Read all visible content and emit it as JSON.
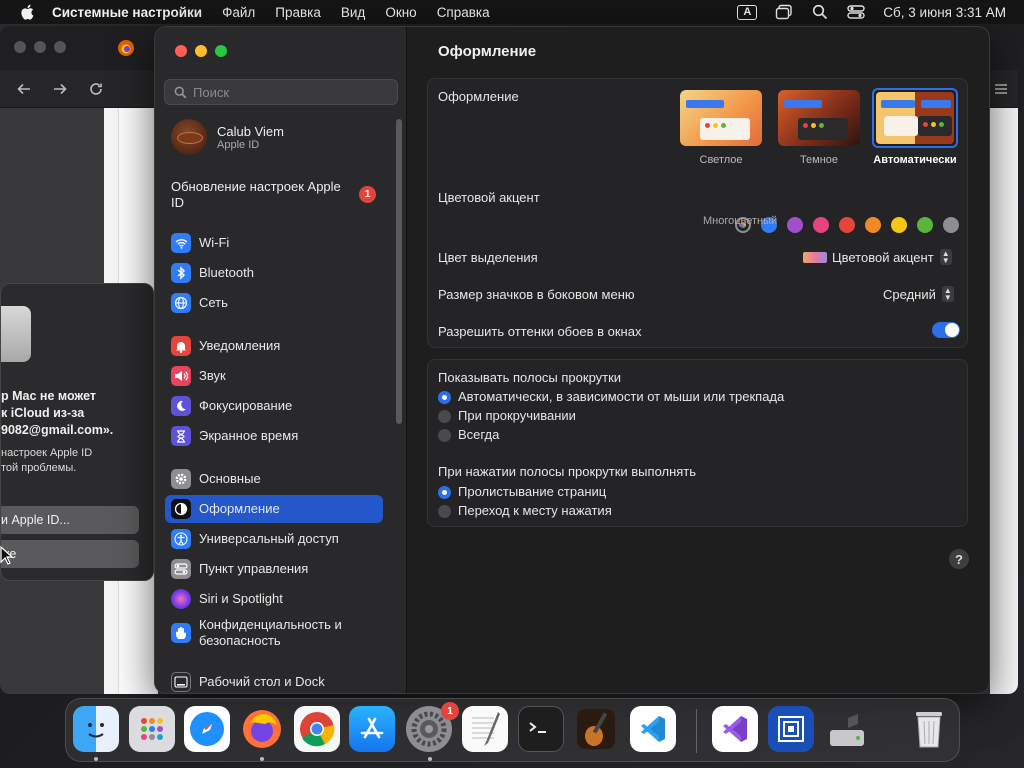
{
  "menubar": {
    "app_name": "Системные настройки",
    "items": [
      "Файл",
      "Правка",
      "Вид",
      "Окно",
      "Справка"
    ],
    "input_source": "A",
    "datetime": "Сб, 3 июня  3:31 AM"
  },
  "dialog": {
    "title": "р Mac не может\nк iCloud из-за\n9082@gmail.com».",
    "body": "настроек Apple ID\nтой проблемы.",
    "button1": "и Apple ID...",
    "button2": "же"
  },
  "sidebar": {
    "search_placeholder": "Поиск",
    "profile_name": "Calub Viem",
    "profile_sub": "Apple ID",
    "update_label": "Обновление настроек Apple ID",
    "update_badge": "1",
    "items": [
      {
        "label": "Wi-Fi",
        "icon": "wifi-icon",
        "color": "#2f7cf6"
      },
      {
        "label": "Bluetooth",
        "icon": "bluetooth-icon",
        "color": "#2f7cf6"
      },
      {
        "label": "Сеть",
        "icon": "globe-icon",
        "color": "#2f7cf6"
      },
      {
        "label": "Уведомления",
        "icon": "bell-icon",
        "color": "#e5453a"
      },
      {
        "label": "Звук",
        "icon": "speaker-icon",
        "color": "#e5455e"
      },
      {
        "label": "Фокусирование",
        "icon": "moon-icon",
        "color": "#5e52d6"
      },
      {
        "label": "Экранное время",
        "icon": "hourglass-icon",
        "color": "#5e52d6"
      },
      {
        "label": "Основные",
        "icon": "gear-icon",
        "color": "#8e8e92"
      },
      {
        "label": "Оформление",
        "icon": "appearance-icon",
        "color": "#111111"
      },
      {
        "label": "Универсальный доступ",
        "icon": "accessibility-icon",
        "color": "#2f7cf6"
      },
      {
        "label": "Пункт управления",
        "icon": "control-center-icon",
        "color": "#8e8e92"
      },
      {
        "label": "Siri и Spotlight",
        "icon": "siri-icon",
        "color": "#a855f7"
      },
      {
        "label": "Конфиденциальность и безопасность",
        "icon": "hand-icon",
        "color": "#2f7cf6"
      },
      {
        "label": "Рабочий стол и Dock",
        "icon": "dock-icon",
        "color": "#2a2a2c"
      }
    ]
  },
  "content": {
    "title": "Оформление",
    "appearance_label": "Оформление",
    "appearance_options": [
      "Светлое",
      "Темное",
      "Автоматически"
    ],
    "appearance_selected": "Автоматически",
    "accent_label": "Цветовой акцент",
    "accent_caption": "Многоцветный",
    "accent_colors": [
      "multicolor",
      "#2f7cf6",
      "#a350c8",
      "#e5457c",
      "#e5453a",
      "#f08a24",
      "#f5c518",
      "#5ab53c",
      "#8e8e92"
    ],
    "highlight_label": "Цвет выделения",
    "highlight_value": "Цветовой акцент",
    "icon_size_label": "Размер значков в боковом меню",
    "icon_size_value": "Средний",
    "tinting_label": "Разрешить оттенки обоев в окнах",
    "tinting_on": true,
    "scrollbars_label": "Показывать полосы прокрутки",
    "scrollbar_options": [
      "Автоматически, в зависимости от мыши или трекпада",
      "При прокручивании",
      "Всегда"
    ],
    "scrollbar_selected": 0,
    "click_label": "При нажатии полосы прокрутки выполнять",
    "click_options": [
      "Пролистывание страниц",
      "Переход к месту нажатия"
    ],
    "click_selected": 0,
    "help": "?"
  },
  "dock": {
    "apps": [
      "Finder",
      "Launchpad",
      "Safari",
      "Firefox",
      "Google Chrome",
      "App Store",
      "Системные настройки",
      "TextEdit",
      "Терминал",
      "GarageBand",
      "Visual Studio Code",
      "Visual Studio",
      "Remote Desktop",
      "Boot Camp",
      "Корзина"
    ],
    "settings_badge": "1"
  }
}
